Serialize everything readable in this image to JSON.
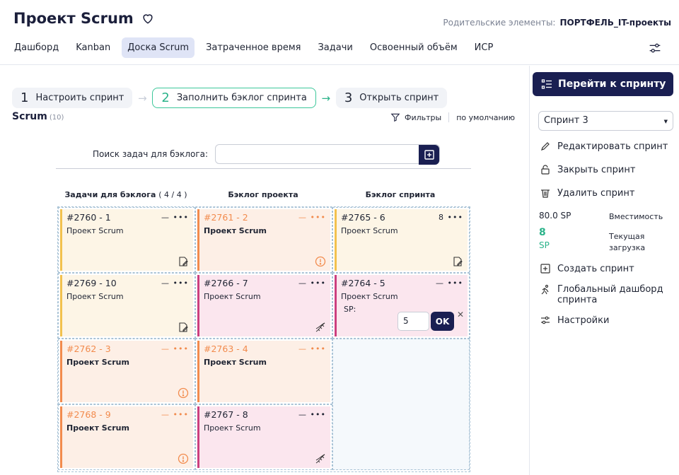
{
  "header": {
    "title": "Проект Scrum",
    "parents_label": "Родительские элементы:",
    "parents_value": "ПОРТФЕЛЬ_IT-проекты",
    "tabs": [
      "Дашборд",
      "Kanban",
      "Доска Scrum",
      "Затраченное время",
      "Задачи",
      "Освоенный объём",
      "ИСР"
    ]
  },
  "steps": [
    {
      "num": "1",
      "label": "Настроить спринт"
    },
    {
      "num": "2",
      "label": "Заполнить бэклог спринта"
    },
    {
      "num": "3",
      "label": "Открыть спринт"
    }
  ],
  "board": {
    "title": "Scrum",
    "count": "(10)",
    "filters_label": "Фильтры",
    "default_label": "по умолчанию",
    "search_label": "Поиск задач для бэклога:",
    "search_value": "",
    "columns": [
      {
        "label": "Задачи для бэклога",
        "extra": "( 4 / 4 )"
      },
      {
        "label": "Бэклог проекта",
        "extra": ""
      },
      {
        "label": "Бэклог спринта",
        "extra": ""
      }
    ],
    "cards": [
      {
        "id": "#2760 - 1",
        "project": "Проект Scrum",
        "menu": "— •••"
      },
      {
        "id": "#2761 - 2",
        "project": "Проект Scrum",
        "menu": "— •••"
      },
      {
        "id": "#2765 - 6",
        "project": "Проект Scrum",
        "menu": "8 •••"
      },
      {
        "id": "#2769 - 10",
        "project": "Проект Scrum",
        "menu": "— •••"
      },
      {
        "id": "#2766 - 7",
        "project": "Проект Scrum",
        "menu": "— •••"
      },
      {
        "id": "#2764 - 5",
        "project": "Проект Scrum",
        "menu": "— •••",
        "sp_label": "SP:",
        "sp_value": "5",
        "ok": "OK"
      },
      {
        "id": "#2762 - 3",
        "project": "Проект Scrum",
        "menu": "— •••"
      },
      {
        "id": "#2763 - 4",
        "project": "Проект Scrum",
        "menu": "— •••"
      },
      {
        "id": "#2768 - 9",
        "project": "Проект Scrum",
        "menu": "— •••"
      },
      {
        "id": "#2767 - 8",
        "project": "Проект Scrum",
        "menu": "— •••"
      }
    ]
  },
  "sidebar": {
    "go_button": "Перейти к спринту",
    "sprint_selected": "Спринт 3",
    "edit": "Редактировать спринт",
    "close": "Закрыть спринт",
    "delete": "Удалить спринт",
    "capacity_value": "80.0 SP",
    "capacity_label": "Вместимость",
    "load_value": "8",
    "load_unit": "SP",
    "load_label_1": "Текущая",
    "load_label_2": "загрузка",
    "create": "Создать спринт",
    "global_dashboard_1": "Глобальный дашборд",
    "global_dashboard_2": "спринта",
    "settings": "Настройки"
  },
  "colors": {
    "accent": "#1a1f52",
    "green": "#2bb38a",
    "orange": "#f28b4d",
    "pink": "#cc3f7f",
    "yellow": "#f2c14e"
  }
}
